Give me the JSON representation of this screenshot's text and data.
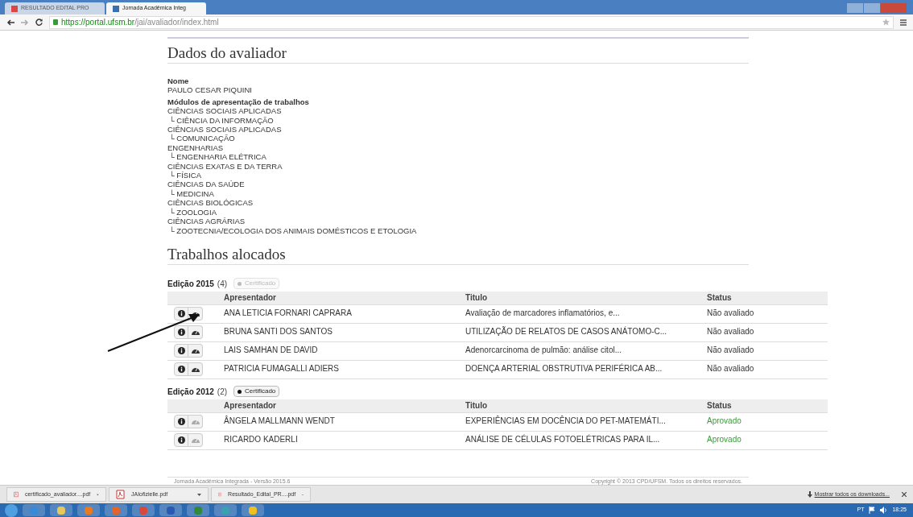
{
  "browser": {
    "tabs": [
      {
        "label": "RESULTADO EDITAL PRO",
        "selected": false
      },
      {
        "label": "Jornada Acadêmica Integ",
        "selected": true
      }
    ],
    "url_host": "https://portal.ufsm.br",
    "url_path": "/jai/avaliador/index.html"
  },
  "evaluator": {
    "title": "Dados do avaliador",
    "name_label": "Nome",
    "name": "PAULO CESAR PIQUINI",
    "modules_label": "Módulos de apresentação de trabalhos",
    "modules": [
      {
        "area": "CIÊNCIAS SOCIAIS APLICADAS",
        "children": [
          {
            "name": "└ CIÊNCIA DA INFORMAÇÃO"
          }
        ]
      },
      {
        "area": "CIÊNCIAS SOCIAIS APLICADAS",
        "children": [
          {
            "name": "└ COMUNICAÇÃO"
          }
        ]
      },
      {
        "area": "ENGENHARIAS",
        "children": [
          {
            "name": "└ ENGENHARIA ELÉTRICA"
          }
        ]
      },
      {
        "area": "CIÊNCIAS EXATAS E DA TERRA",
        "children": [
          {
            "name": "└ FÍSICA"
          }
        ]
      },
      {
        "area": "CIÊNCIAS DA SAÚDE",
        "children": [
          {
            "name": "└ MEDICINA"
          }
        ]
      },
      {
        "area": "CIÊNCIAS BIOLÓGICAS",
        "children": [
          {
            "name": "└ ZOOLOGIA"
          }
        ]
      },
      {
        "area": "CIÊNCIAS AGRÁRIAS",
        "children": [
          {
            "name": "└ ZOOTECNIA/ECOLOGIA DOS ANIMAIS DOMÉSTICOS E ETOLOGIA"
          }
        ]
      }
    ]
  },
  "works": {
    "title": "Trabalhos alocados",
    "editions": [
      {
        "label": "Edição 2015",
        "count": "(4)",
        "columns": [
          "Apresentador",
          "Titulo",
          "Status"
        ],
        "certificate": "Certificado",
        "certified": false,
        "rows": [
          {
            "presenter": "ANA LETICIA FORNARI CAPRARA",
            "title": "Avaliação de marcadores inflamatórios, e...",
            "status": "Não avaliado",
            "approved": false,
            "evaluate_enabled": true
          },
          {
            "presenter": "BRUNA SANTI DOS SANTOS",
            "title": "UTILIZAÇÃO DE RELATOS DE CASOS ANÁTOMO-C...",
            "status": "Não avaliado",
            "approved": false,
            "evaluate_enabled": true
          },
          {
            "presenter": "LAIS SAMHAN DE DAVID",
            "title": "Adenorcarcinoma de pulmão: análise citol...",
            "status": "Não avaliado",
            "approved": false,
            "evaluate_enabled": true
          },
          {
            "presenter": "PATRICIA FUMAGALLI ADIERS",
            "title": "DOENÇA ARTERIAL OBSTRUTIVA PERIFÉRICA AB...",
            "status": "Não avaliado",
            "approved": false,
            "evaluate_enabled": true
          }
        ]
      },
      {
        "label": "Edição 2012",
        "count": "(2)",
        "columns": [
          "Apresentador",
          "Titulo",
          "Status"
        ],
        "certificate": "Certificado",
        "certified": true,
        "rows": [
          {
            "presenter": "ÂNGELA MALLMANN WENDT",
            "title": "EXPERIÊNCIAS EM DOCÊNCIA DO PET-MATEMÁTI...",
            "status": "Aprovado",
            "approved": true,
            "evaluate_enabled": false
          },
          {
            "presenter": "RICARDO KADERLI",
            "title": "ANÁLISE DE CÉLULAS FOTOELÉTRICAS PARA IL...",
            "status": "Aprovado",
            "approved": true,
            "evaluate_enabled": false
          }
        ]
      }
    ]
  },
  "footer": {
    "left": "Jornada Acadêmica Integrada - Versão 2015.6",
    "right": "Copyright © 2013 CPD/UFSM. Todos os direitos reservados."
  },
  "downloads": {
    "files": [
      "certificado_avaliador....pdf",
      "JAIofizielle.pdf",
      "Resultado_Edital_PR....pdf"
    ],
    "show_all": "Mostrar todos os downloads..."
  },
  "taskbar": {
    "language": "PT",
    "time": "18:25"
  }
}
